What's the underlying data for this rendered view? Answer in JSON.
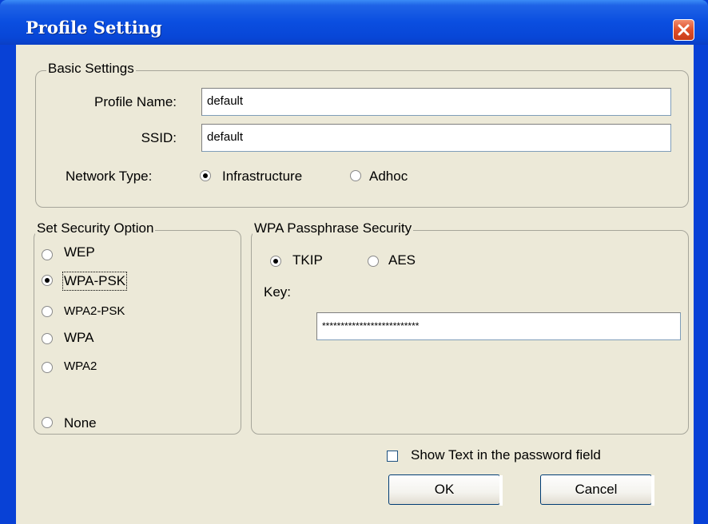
{
  "window": {
    "title": "Profile Setting"
  },
  "basic_settings": {
    "legend": "Basic Settings",
    "profile_name_label": "Profile Name:",
    "profile_name_value": "default",
    "ssid_label": "SSID:",
    "ssid_value": "default",
    "network_type_label": "Network Type:",
    "network_types": [
      {
        "label": "Infrastructure",
        "selected": true
      },
      {
        "label": "Adhoc",
        "selected": false
      }
    ]
  },
  "security_option": {
    "legend": "Set Security Option",
    "options": [
      {
        "label": "WEP",
        "selected": false
      },
      {
        "label": "WPA-PSK",
        "selected": true
      },
      {
        "label": "WPA2-PSK",
        "selected": false
      },
      {
        "label": "WPA",
        "selected": false
      },
      {
        "label": "WPA2",
        "selected": false
      },
      {
        "label": "None",
        "selected": false
      }
    ]
  },
  "wpa_passphrase": {
    "legend": "WPA Passphrase Security",
    "encryption": [
      {
        "label": "TKIP",
        "selected": true
      },
      {
        "label": "AES",
        "selected": false
      }
    ],
    "key_label": "Key:",
    "key_value": "**************************"
  },
  "show_text": {
    "label": "Show Text in the password field",
    "checked": false
  },
  "buttons": {
    "ok": "OK",
    "cancel": "Cancel"
  }
}
